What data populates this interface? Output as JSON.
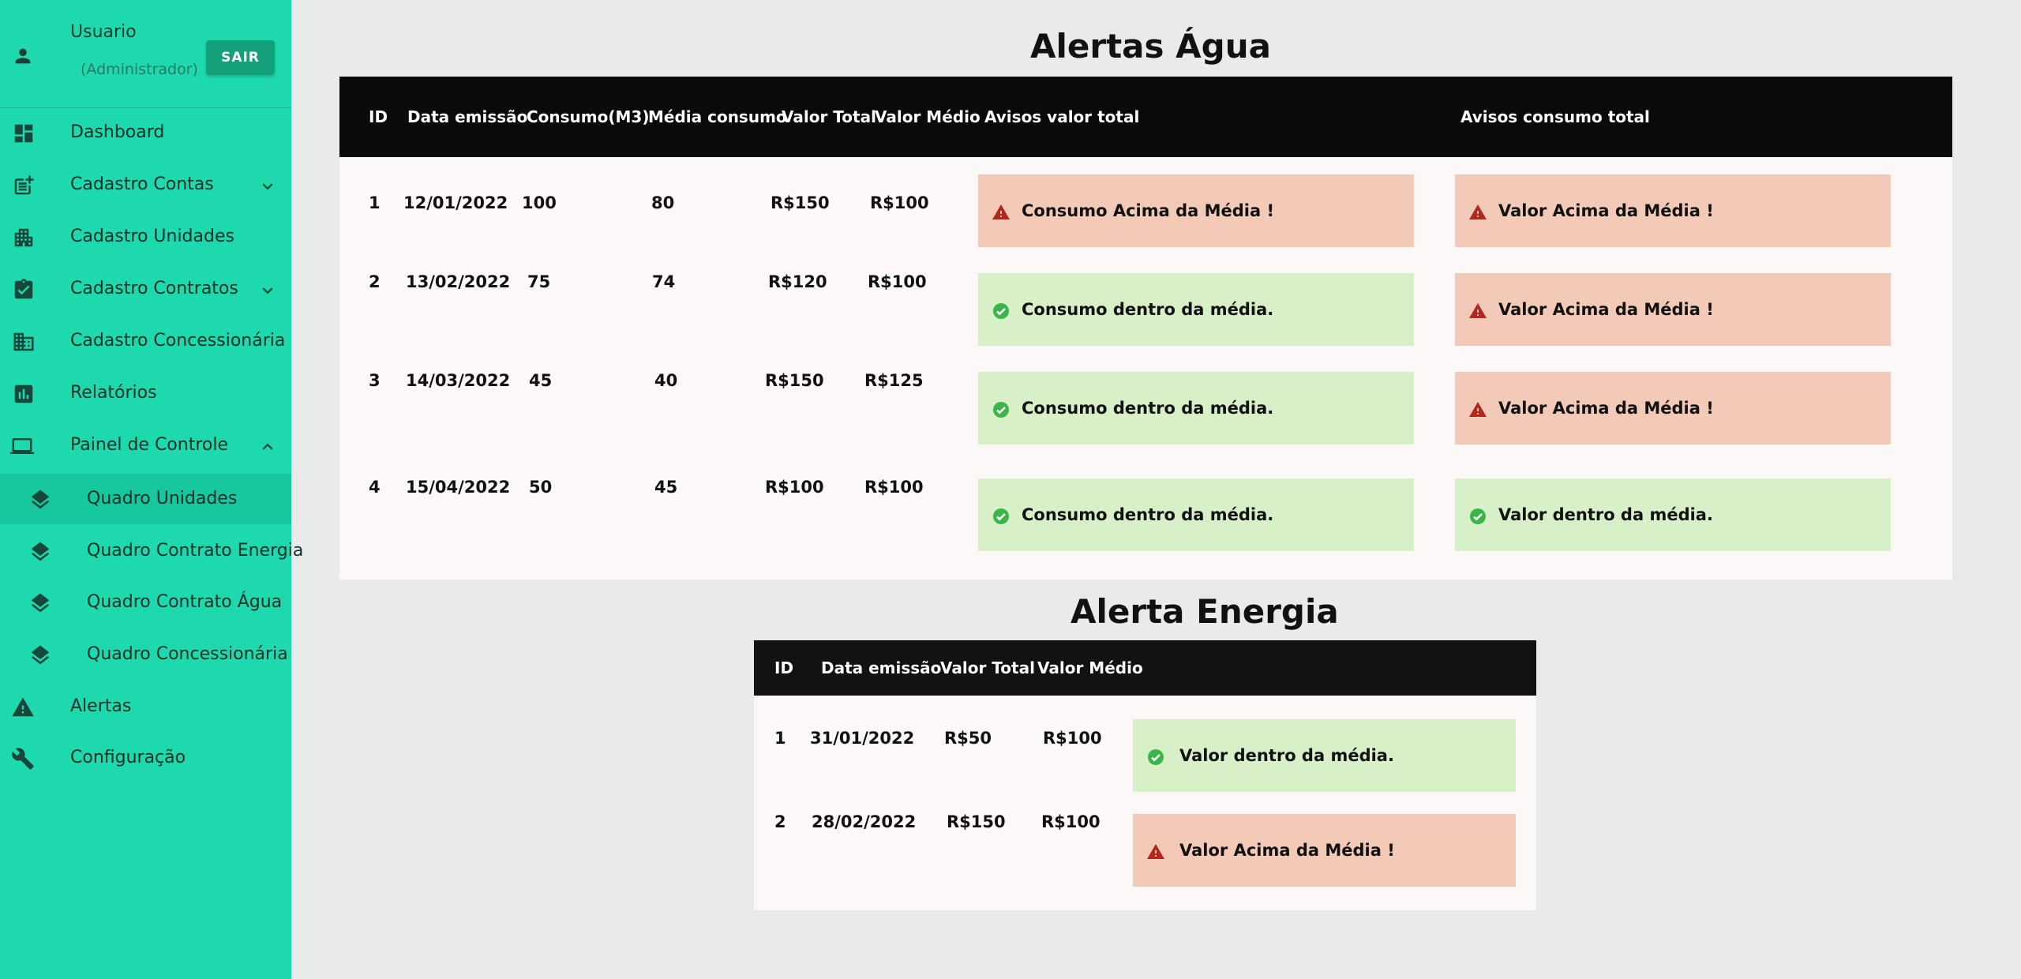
{
  "user": {
    "name": "Usuario",
    "role": "(Administrador)",
    "logout_label": "SAIR"
  },
  "nav": {
    "dashboard": "Dashboard",
    "cadastro_contas": "Cadastro Contas",
    "cadastro_unidades": "Cadastro Unidades",
    "cadastro_contratos": "Cadastro Contratos",
    "cadastro_concessionaria": "Cadastro Concessionária",
    "relatorios": "Relatórios",
    "painel_controle": "Painel de Controle",
    "quadro_unidades": "Quadro Unidades",
    "quadro_contrato_energia": "Quadro Contrato Energia",
    "quadro_contrato_agua": "Quadro Contrato Água",
    "quadro_concessionaria": "Quadro Concessionária",
    "alertas": "Alertas",
    "configuracao": "Configuração"
  },
  "agua": {
    "title": "Alertas Água",
    "headers": [
      "ID",
      "Data emissão",
      "Consumo(M3)",
      "Média consumo",
      "Valor Total",
      "Valor Médio",
      "Avisos valor total",
      "Avisos consumo total"
    ],
    "rows": [
      {
        "id": "1",
        "date": "12/01/2022",
        "consumo": "100",
        "media": "80",
        "total": "R$150",
        "medio": "R$100",
        "alert1": "Consumo Acima da Média !",
        "alert1_status": "warn",
        "alert2": "Valor Acima da Média !",
        "alert2_status": "warn"
      },
      {
        "id": "2",
        "date": "13/02/2022",
        "consumo": "75",
        "media": "74",
        "total": "R$120",
        "medio": "R$100",
        "alert1": "Consumo dentro da média.",
        "alert1_status": "ok",
        "alert2": "Valor Acima da Média !",
        "alert2_status": "warn"
      },
      {
        "id": "3",
        "date": "14/03/2022",
        "consumo": "45",
        "media": "40",
        "total": "R$150",
        "medio": "R$125",
        "alert1": "Consumo dentro da média.",
        "alert1_status": "ok",
        "alert2": "Valor Acima da Média !",
        "alert2_status": "warn"
      },
      {
        "id": "4",
        "date": "15/04/2022",
        "consumo": "50",
        "media": "45",
        "total": "R$100",
        "medio": "R$100",
        "alert1": "Consumo dentro da média.",
        "alert1_status": "ok",
        "alert2": "Valor dentro da média.",
        "alert2_status": "ok"
      }
    ]
  },
  "energia": {
    "title": "Alerta Energia",
    "headers": [
      "ID",
      "Data emissão",
      "Valor Total",
      "Valor Médio"
    ],
    "rows": [
      {
        "id": "1",
        "date": "31/01/2022",
        "total": "R$50",
        "medio": "R$100",
        "alert": "Valor dentro da média.",
        "alert_status": "ok"
      },
      {
        "id": "2",
        "date": "28/02/2022",
        "total": "R$150",
        "medio": "R$100",
        "alert": "Valor Acima da Média !",
        "alert_status": "warn"
      }
    ]
  },
  "colors": {
    "sidebar": "#1dd9ad",
    "warn_bg": "#f3c9b8",
    "ok_bg": "#d7f0c8",
    "warn_icon": "#b3261e",
    "ok_icon": "#3bb54a",
    "header_bg": "#0a0a0a"
  }
}
